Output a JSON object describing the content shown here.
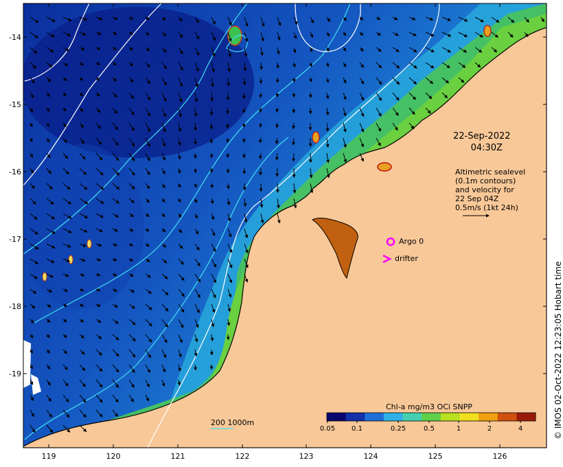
{
  "date_time": {
    "date": "22-Sep-2022",
    "time": "04:30Z"
  },
  "description_lines": [
    "Altimetric sealevel",
    "(0.1m contours)",
    "and velocity for",
    "22 Sep 04Z",
    "0.5m/s (1kt 24h)"
  ],
  "legend": {
    "argo_label": "Argo 0",
    "drifter_label": "drifter",
    "marker_color": "#ff00ff"
  },
  "scale_label": "200  1000m",
  "credit": "© IMOS 02-Oct-2022 12:23:05 Hobart time",
  "colorbar": {
    "title": "Chl-a mg/m3 OCi SNPP",
    "ticks": [
      "0.05",
      "0.1",
      "0.25",
      "0.5",
      "1",
      "2",
      "4"
    ],
    "colors": [
      "#08086e",
      "#1330a8",
      "#1f6fd6",
      "#2fb0e6",
      "#42d0b0",
      "#5fd04a",
      "#b8e020",
      "#f0e020",
      "#f0a010",
      "#d05010",
      "#9a1a0a"
    ]
  },
  "axes": {
    "lon_ticks": [
      "119",
      "120",
      "121",
      "122",
      "123",
      "124",
      "125",
      "126"
    ],
    "lat_ticks": [
      "-14",
      "-15",
      "-16",
      "-17",
      "-18",
      "-19"
    ]
  },
  "map_colors": {
    "land": "#f8c898",
    "deep_ocean": "#0a2a9a",
    "mid_ocean": "#1a66d0",
    "shelf": "#2ab0d8",
    "coastal": "#5cc848"
  }
}
